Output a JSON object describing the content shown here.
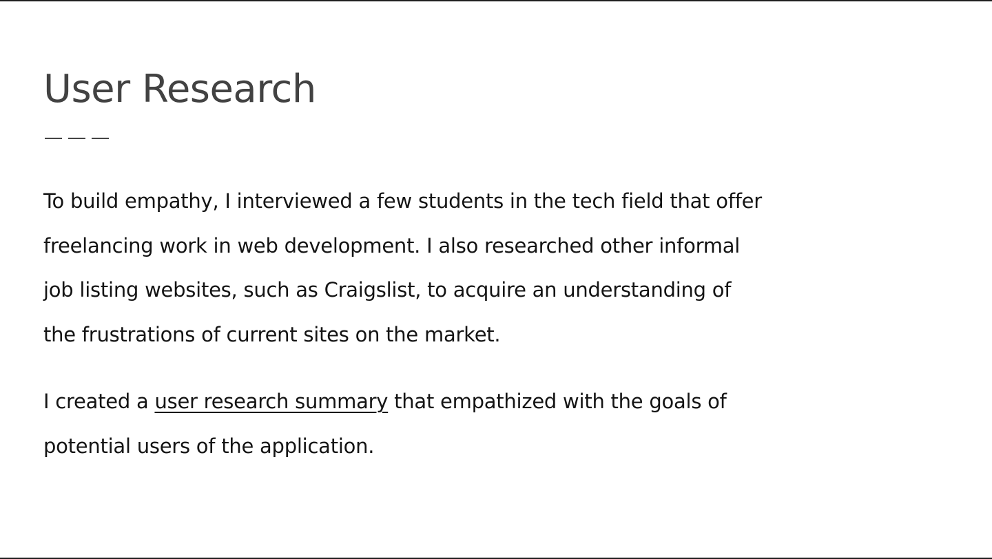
{
  "slide": {
    "title": "User Research",
    "divider": "___",
    "paragraph_1": [
      "To build empathy, I interviewed a few students in the tech field that offer",
      "freelancing work in web development. I also researched other informal",
      "job listing websites, such as Craigslist, to acquire an understanding of",
      "the frustrations of current sites on the market."
    ],
    "paragraph_2": {
      "line_1_before": "I created a ",
      "link_text": "user research summary",
      "line_1_after": " that empathized with the goals of",
      "line_2": "potential users of the application."
    }
  },
  "colors": {
    "background": "#ffffff",
    "title": "#424242",
    "body_text": "#141414",
    "border": "#1f1f1f"
  }
}
